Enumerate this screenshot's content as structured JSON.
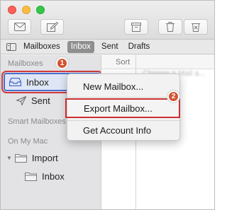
{
  "favorites_bar": {
    "items": [
      "Mailboxes",
      "Inbox",
      "Sent",
      "Drafts"
    ]
  },
  "sidebar": {
    "mailboxes_header": "Mailboxes",
    "inbox_label": "Inbox",
    "sent_label": "Sent",
    "smart_header": "Smart Mailboxes",
    "on_my_mac_header": "On My Mac",
    "import_label": "Import",
    "import_inbox_label": "Inbox"
  },
  "list": {
    "sort_label": "Sort",
    "preview_placeholder": "Choose a Mail a..."
  },
  "context_menu": {
    "items": [
      "New Mailbox...",
      "Export Mailbox...",
      "Get Account Info"
    ]
  },
  "badges": [
    "1",
    "2"
  ],
  "colors": {
    "highlight_red": "#cc2f2f",
    "badge_orange": "#d35431",
    "selection_blue": "#4a6fd0"
  }
}
